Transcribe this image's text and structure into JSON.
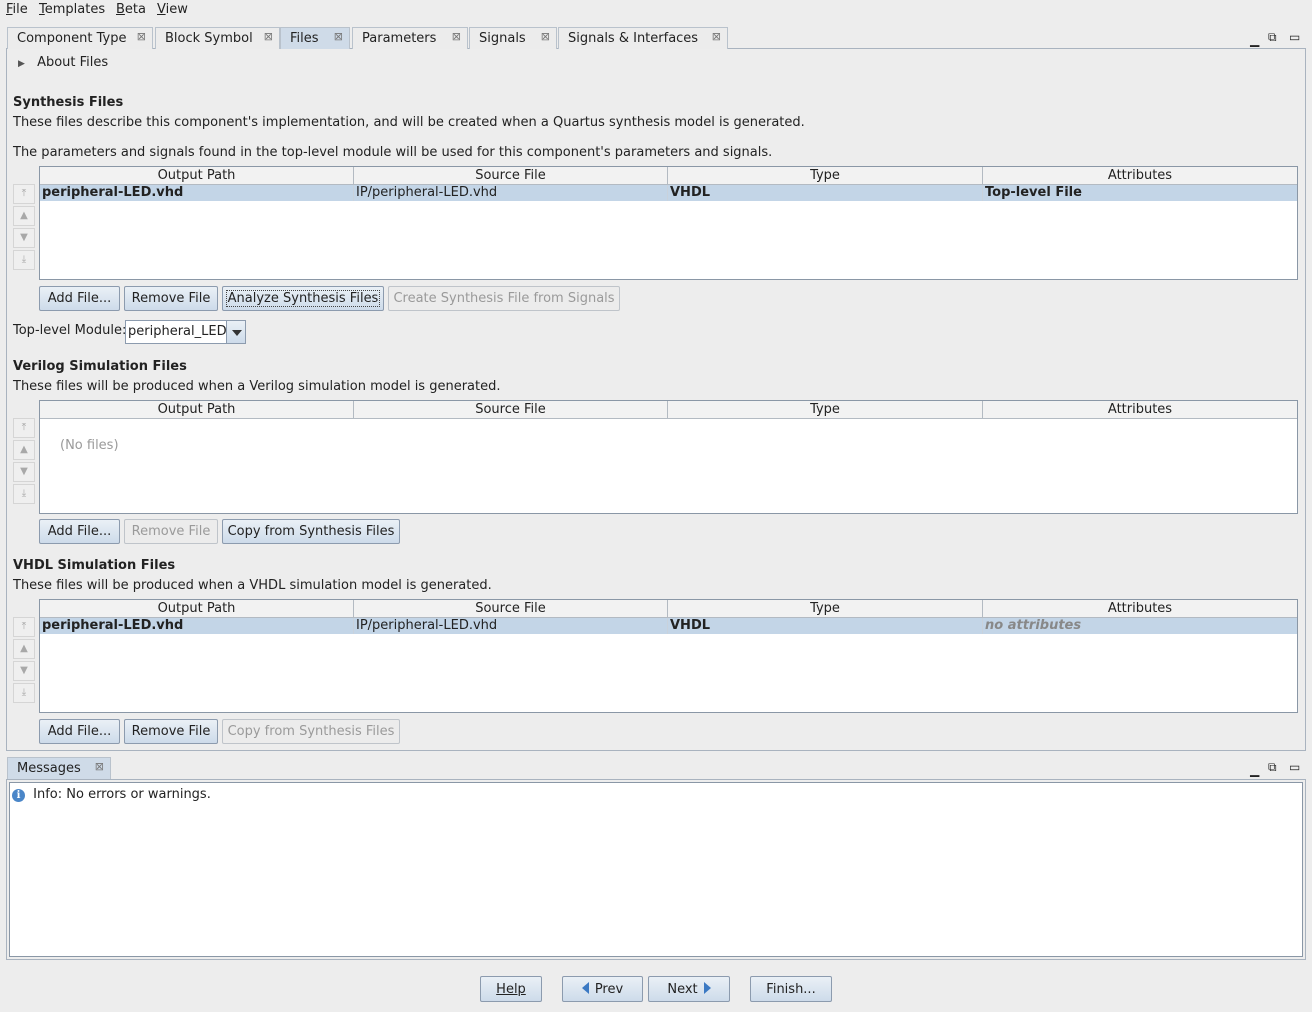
{
  "menu": [
    {
      "label": "File",
      "mnemonic": "F",
      "rest": "ile"
    },
    {
      "label": "Templates",
      "mnemonic": "T",
      "rest": "emplates"
    },
    {
      "label": "Beta",
      "mnemonic": "B",
      "rest": "eta"
    },
    {
      "label": "View",
      "mnemonic": "V",
      "rest": "iew"
    }
  ],
  "tabs": [
    "Component Type",
    "Block Symbol",
    "Files",
    "Parameters",
    "Signals",
    "Signals & Interfaces"
  ],
  "active_tab": "Files",
  "about": "About Files",
  "synthesis": {
    "title": "Synthesis Files",
    "desc1": "These files describe this component's implementation, and will be created when a Quartus synthesis model is generated.",
    "desc2": "The parameters and signals found in the top-level module will be used for this component's parameters and signals.",
    "columns": [
      "Output Path",
      "Source File",
      "Type",
      "Attributes"
    ],
    "rows": [
      [
        "peripheral-LED.vhd",
        "IP/peripheral-LED.vhd",
        "VHDL",
        "Top-level File"
      ]
    ],
    "buttons": [
      "Add File...",
      "Remove File",
      "Analyze Synthesis Files",
      "Create Synthesis File from Signals"
    ],
    "top_level_label": "Top-level Module:",
    "top_level_value": "peripheral_LED"
  },
  "verilog": {
    "title": "Verilog Simulation Files",
    "desc": "These files will be produced when a Verilog simulation model is generated.",
    "columns": [
      "Output Path",
      "Source File",
      "Type",
      "Attributes"
    ],
    "empty": "(No files)",
    "buttons": [
      "Add File...",
      "Remove File",
      "Copy from Synthesis Files"
    ]
  },
  "vhdl": {
    "title": "VHDL Simulation Files",
    "desc": "These files will be produced when a VHDL simulation model is generated.",
    "columns": [
      "Output Path",
      "Source File",
      "Type",
      "Attributes"
    ],
    "rows": [
      [
        "peripheral-LED.vhd",
        "IP/peripheral-LED.vhd",
        "VHDL",
        "no attributes"
      ]
    ],
    "buttons": [
      "Add File...",
      "Remove File",
      "Copy from Synthesis Files"
    ]
  },
  "messages": {
    "tab": "Messages",
    "info": "Info: No errors or warnings."
  },
  "footer": {
    "help": "Help",
    "prev": "Prev",
    "next": "Next",
    "finish": "Finish..."
  },
  "colors": {
    "selection": "#c3d5e7",
    "active_tab": "#cfdbe8",
    "info_icon": "#4a86c8"
  }
}
